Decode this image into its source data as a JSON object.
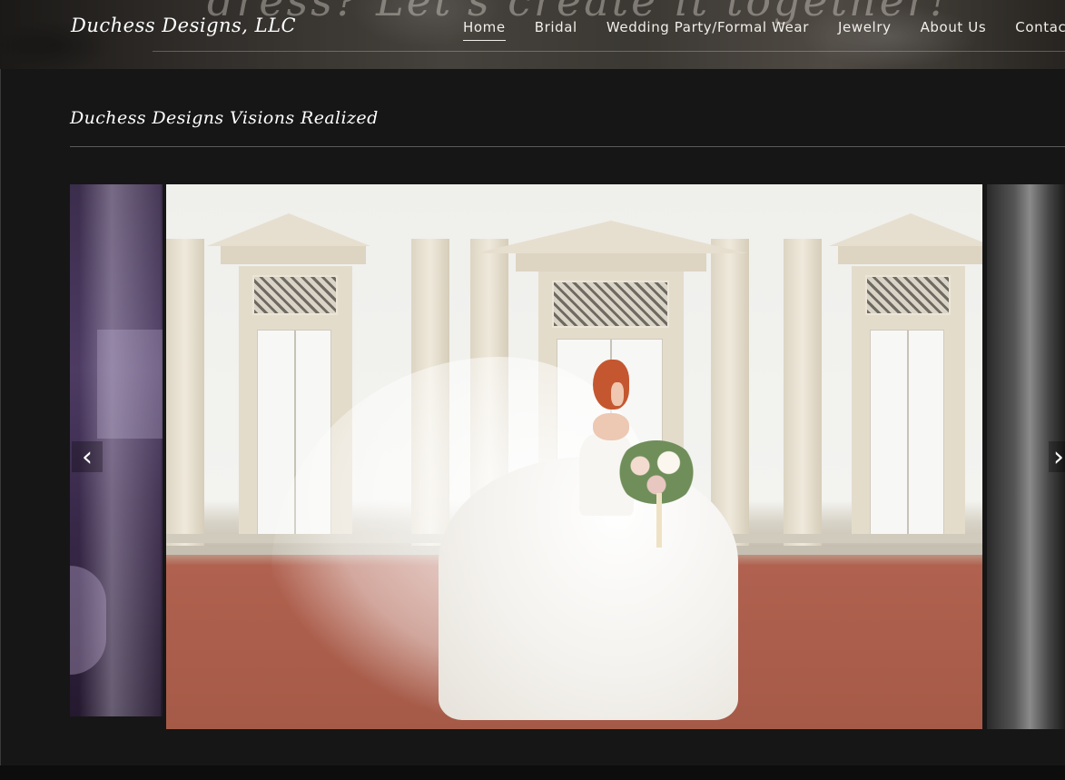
{
  "site": {
    "logo": "Duchess Designs, LLC"
  },
  "hero": {
    "tagline": "dress? Let's create it together!",
    "subtext": ""
  },
  "nav": {
    "items": [
      {
        "label": "Home",
        "active": true
      },
      {
        "label": "Bridal",
        "active": false
      },
      {
        "label": "Wedding Party/Formal Wear",
        "active": false
      },
      {
        "label": "Jewelry",
        "active": false
      },
      {
        "label": "About Us",
        "active": false
      },
      {
        "label": "Contact Us",
        "active": false
      }
    ]
  },
  "section": {
    "title": "Duchess Designs Visions Realized"
  },
  "carousel": {
    "prev_icon": "chevron-left-icon",
    "next_icon": "chevron-right-icon",
    "prev_glyph": "‹",
    "next_glyph": "›"
  },
  "colors": {
    "background": "#161616",
    "text": "#ffffff",
    "rule": "#5a5a5a"
  }
}
